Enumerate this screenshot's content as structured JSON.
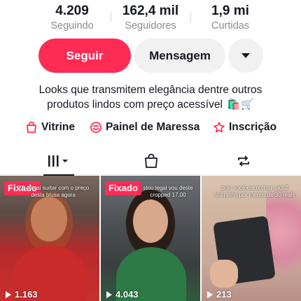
{
  "stats": [
    {
      "value": "4.209",
      "label": "Seguindo"
    },
    {
      "value": "162,4 mil",
      "label": "Seguidores"
    },
    {
      "value": "1,9 mi",
      "label": "Curtidas"
    }
  ],
  "actions": {
    "follow_label": "Seguir",
    "message_label": "Mensagem",
    "more_icon": "chevron-down-icon"
  },
  "bio": {
    "line1": "Looks que transmitem elegância dentre outros",
    "line2": "produtos lindos com preço acessível",
    "emoji": "🛍️🛒"
  },
  "links": [
    {
      "label": "Vitrine",
      "icon": "shopping-bag-icon"
    },
    {
      "label": "Painel de Maressa",
      "icon": "panel-icon"
    },
    {
      "label": "Inscrição",
      "icon": "subscription-star-icon"
    }
  ],
  "tabs": [
    {
      "name": "videos",
      "icon": "grid-icon",
      "active": true
    },
    {
      "name": "shop",
      "icon": "bag-icon",
      "active": false
    },
    {
      "name": "reposts",
      "icon": "repost-icon",
      "active": false
    }
  ],
  "videos": [
    {
      "pinned_label": "Fixado",
      "overlay": "R$ 40 vai surtar com o preço desta blusa agora",
      "views": "1.163"
    },
    {
      "pinned_label": "Fixado",
      "overlay": "stou legal vou deste cropped 17,00",
      "views": "4.043"
    },
    {
      "pinned_label": "",
      "overlay": "pov: você encontrou o kit 2 shortinho por menos de 30 reais",
      "views": "213"
    }
  ],
  "colors": {
    "accent": "#fe2c55",
    "text": "#161823",
    "muted": "#8a8b91",
    "button_bg": "#f1f1f2"
  }
}
